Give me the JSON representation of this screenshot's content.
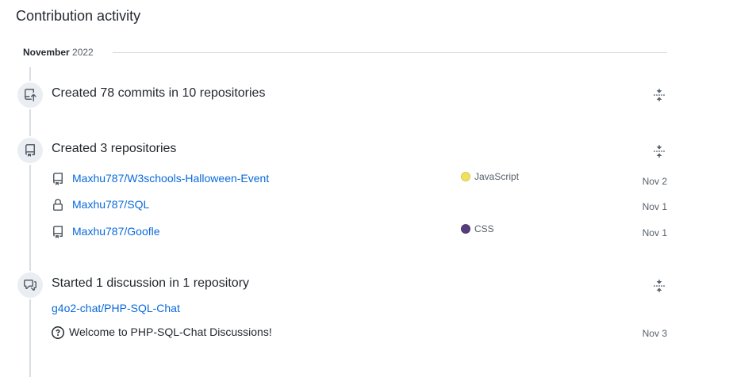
{
  "section": {
    "title": "Contribution activity"
  },
  "month": {
    "name": "November",
    "year": "2022"
  },
  "events": {
    "commits": {
      "title": "Created 78 commits in 10 repositories",
      "icon": "repo-push-icon"
    },
    "repos": {
      "title": "Created 3 repositories",
      "icon": "repo-icon",
      "items": [
        {
          "name": "Maxhu787/W3schools-Halloween-Event",
          "icon": "repo-icon",
          "language": "JavaScript",
          "lang_color": "#f1e05a",
          "date": "Nov 2"
        },
        {
          "name": "Maxhu787/SQL",
          "icon": "lock-icon",
          "language": "",
          "lang_color": "",
          "date": "Nov 1"
        },
        {
          "name": "Maxhu787/Goofle",
          "icon": "repo-icon",
          "language": "CSS",
          "lang_color": "#563d7c",
          "date": "Nov 1"
        }
      ]
    },
    "discussion": {
      "title": "Started 1 discussion in 1 repository",
      "icon": "comment-discussion-icon",
      "repo": "g4o2-chat/PHP-SQL-Chat",
      "item": {
        "title": "Welcome to PHP-SQL-Chat Discussions!",
        "icon": "question-icon",
        "date": "Nov 3"
      }
    }
  }
}
